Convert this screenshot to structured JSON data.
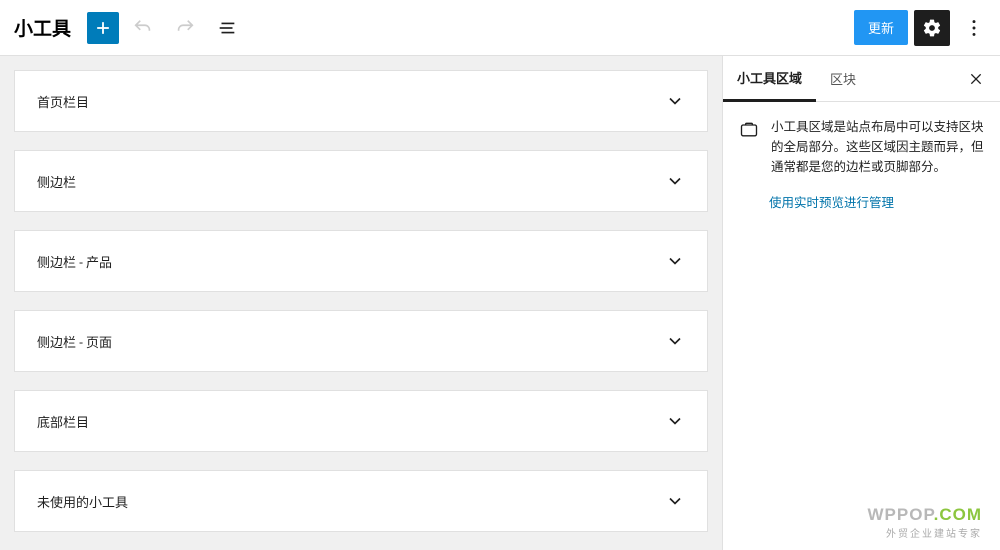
{
  "header": {
    "title": "小工具",
    "update_label": "更新"
  },
  "widget_areas": [
    {
      "label": "首页栏目"
    },
    {
      "label": "侧边栏"
    },
    {
      "label": "侧边栏 - 产品"
    },
    {
      "label": "侧边栏 - 页面"
    },
    {
      "label": "底部栏目"
    },
    {
      "label": "未使用的小工具"
    }
  ],
  "sidebar": {
    "tabs": {
      "areas": "小工具区域",
      "blocks": "区块"
    },
    "description": "小工具区域是站点布局中可以支持区块的全局部分。这些区域因主题而异，但通常都是您的边栏或页脚部分。",
    "link": "使用实时预览进行管理"
  },
  "watermark": {
    "brand1": "WPPOP",
    "brand2": ".COM",
    "tagline": "外贸企业建站专家"
  }
}
